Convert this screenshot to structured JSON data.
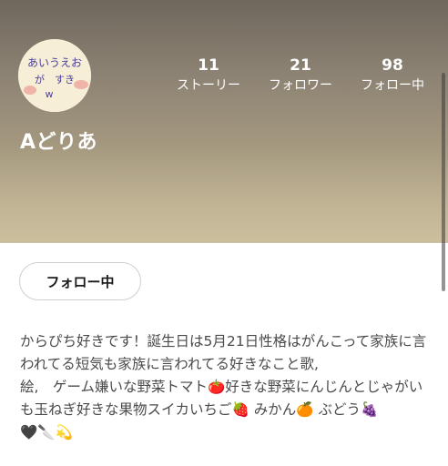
{
  "profile": {
    "avatar_text": "あいうえお が すき w",
    "name": "Aどりあ",
    "stats": {
      "stories": {
        "value": "11",
        "label": "ストーリー"
      },
      "followers": {
        "value": "21",
        "label": "フォロワー"
      },
      "following": {
        "value": "98",
        "label": "フォロー中"
      }
    },
    "follow_button_label": "フォロー中",
    "bio": "からぴち好きです！誕生日は5月21日性格はがんこって家族に言われてる短気も家族に言われてる好きなこと歌,\n絵,　ゲーム嫌いな野菜トマト🍅好きな野菜にんじんとじゃがいも玉ねぎ好きな果物スイカいちご🍓 みかん🍊 ぶどう🍇　　　　　🖤🔪💫"
  },
  "colors": {
    "header_top": "#6f675d",
    "header_bottom": "#cbbf9e",
    "avatar_bg": "#f6eed6",
    "text_primary": "#1a1a1a",
    "bio_text": "#4a4a4a"
  }
}
